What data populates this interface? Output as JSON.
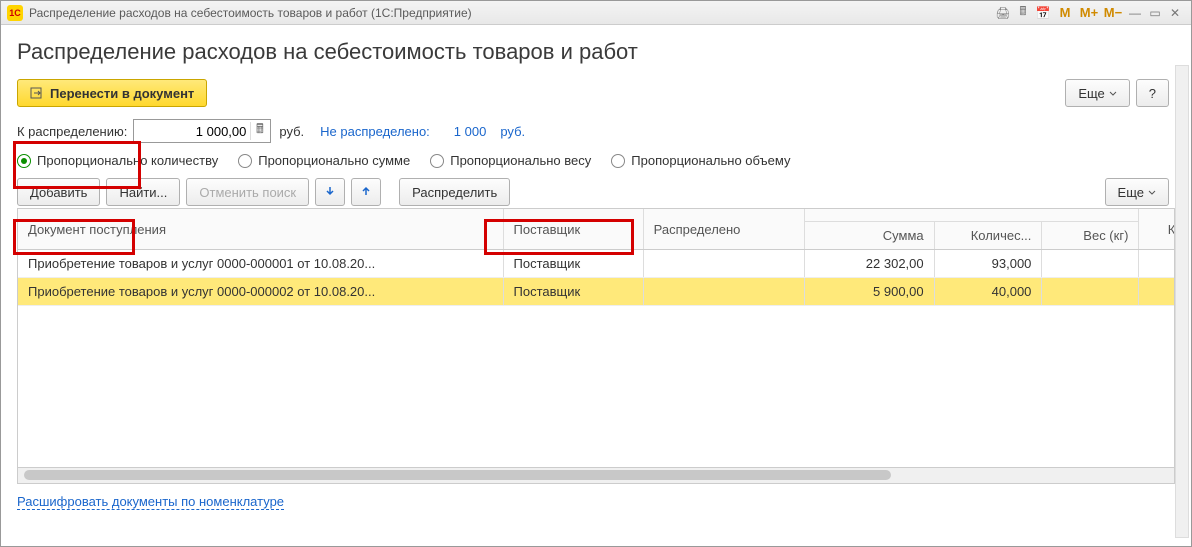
{
  "window": {
    "title": "Распределение расходов на себестоимость товаров и работ  (1С:Предприятие)"
  },
  "page": {
    "heading": "Распределение расходов на себестоимость товаров и работ"
  },
  "toolbar_top": {
    "transfer": "Перенести в документ",
    "more": "Еще",
    "help": "?"
  },
  "amount": {
    "label": "К распределению:",
    "value": "1 000,00",
    "currency": "руб.",
    "unallocated_label": "Не распределено:",
    "unallocated_value": "1 000",
    "unallocated_currency": "руб."
  },
  "radios": {
    "qty": "Пропорционально количеству",
    "sum": "Пропорционально сумме",
    "weight": "Пропорционально весу",
    "volume": "Пропорционально объему"
  },
  "toolbar_table": {
    "add": "Добавить",
    "find": "Найти...",
    "cancel_search": "Отменить поиск",
    "distribute": "Распределить",
    "more": "Еще"
  },
  "table": {
    "headers": {
      "doc": "Документ поступления",
      "supplier": "Поставщик",
      "distributed": "Распределено",
      "sum": "Сумма",
      "qty": "Количес...",
      "weight": "Вес (кг)",
      "coeff": "Коэффициен"
    },
    "rows": [
      {
        "doc": "Приобретение товаров и услуг 0000-000001 от 10.08.20...",
        "supplier": "Поставщик",
        "sum": "22 302,00",
        "qty": "93,000",
        "weight": ""
      },
      {
        "doc": "Приобретение товаров и услуг 0000-000002 от 10.08.20...",
        "supplier": "Поставщик",
        "sum": "5 900,00",
        "qty": "40,000",
        "weight": ""
      }
    ]
  },
  "footer": {
    "decode_link": "Расшифровать документы по номенклатуре"
  }
}
